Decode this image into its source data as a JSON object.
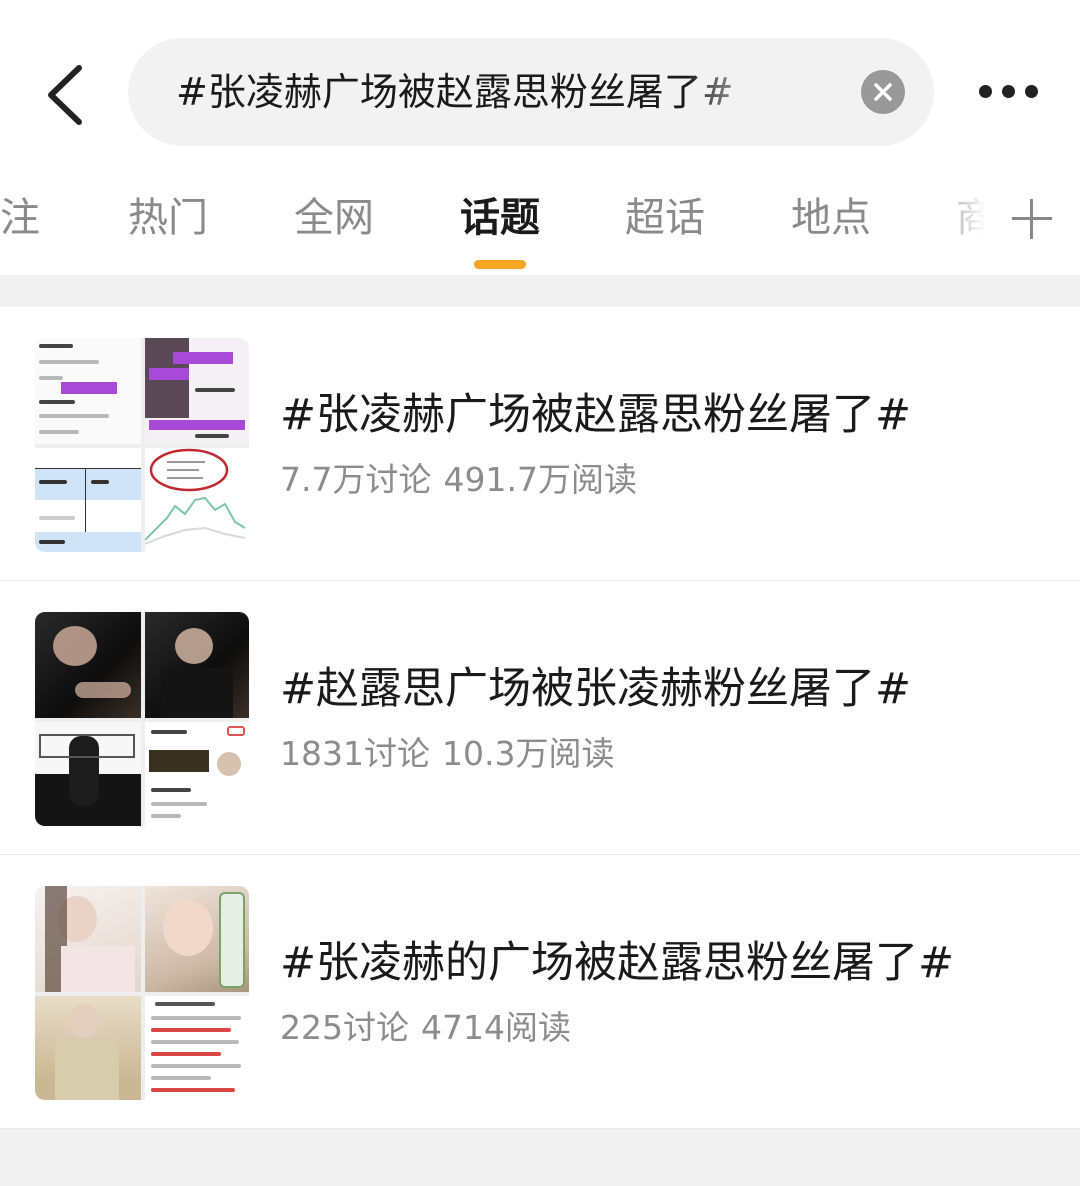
{
  "search": {
    "query": "#张凌赫广场被赵露思粉丝屠了#"
  },
  "tabs": [
    {
      "label": "关注",
      "active": false
    },
    {
      "label": "热门",
      "active": false
    },
    {
      "label": "全网",
      "active": false
    },
    {
      "label": "话题",
      "active": true
    },
    {
      "label": "超话",
      "active": false
    },
    {
      "label": "地点",
      "active": false
    },
    {
      "label": "商",
      "active": false
    }
  ],
  "icons": {
    "back": "chevron-left-icon",
    "clear": "close-circle-icon",
    "more": "more-dots-icon",
    "add_tab": "plus-icon"
  },
  "colors": {
    "accent": "#f7a623",
    "text_primary": "#1a1a1a",
    "text_secondary": "#8c8c8c",
    "highlight_purple": "#a84ad8"
  },
  "results": [
    {
      "title": "#张凌赫广场被赵露思粉丝屠了#",
      "discussions": "7.7万讨论",
      "reads": "491.7万阅读"
    },
    {
      "title": "#赵露思广场被张凌赫粉丝屠了#",
      "discussions": "1831讨论",
      "reads": "10.3万阅读"
    },
    {
      "title": "#张凌赫的广场被赵露思粉丝屠了#",
      "discussions": "225讨论",
      "reads": "4714阅读"
    }
  ]
}
